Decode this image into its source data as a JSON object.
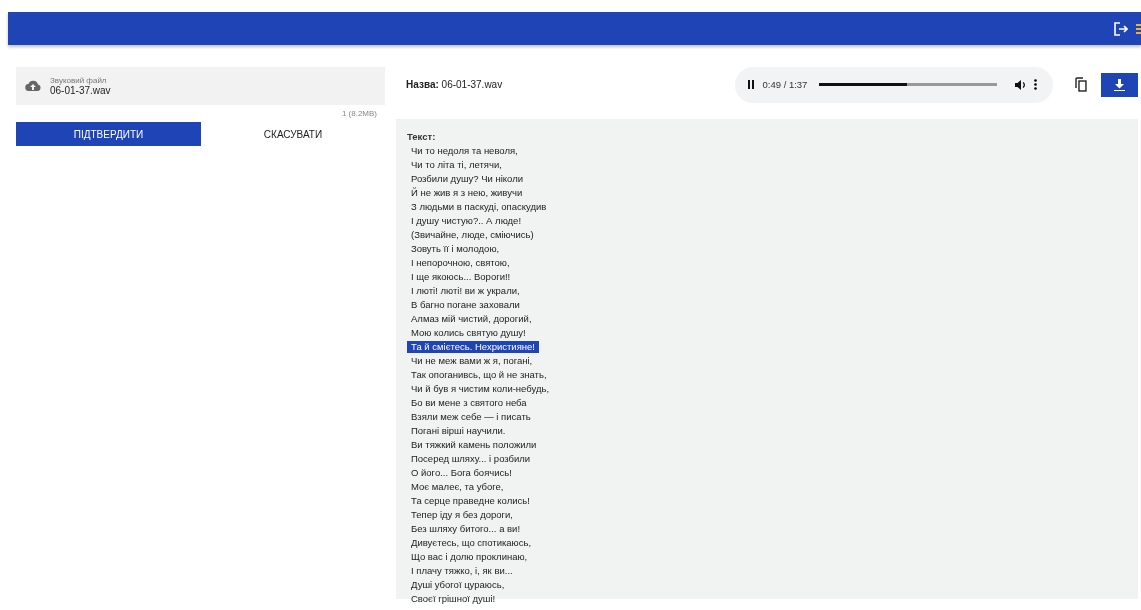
{
  "upload": {
    "label": "Звуковий файл",
    "value": "06-01-37.wav",
    "count": "1 (8.2MB)"
  },
  "buttons": {
    "confirm": "ПІДТВЕРДИТИ",
    "cancel": "СКАСУВАТИ"
  },
  "name": {
    "label": "Назва:",
    "value": "06-01-37.wav"
  },
  "player": {
    "playing": true,
    "time": "0:49 / 1:37",
    "level": 0.49
  },
  "text": {
    "label": "Текст:",
    "lines": [
      {
        "text": "Чи то недоля та неволя,",
        "selected": false
      },
      {
        "text": "Чи то літа ті, летячи,",
        "selected": false
      },
      {
        "text": "Розбили душу? Чи ніколи",
        "selected": false
      },
      {
        "text": "Й не жив я з нею, живучи",
        "selected": false
      },
      {
        "text": "З людьми в паскуді, опаскудив",
        "selected": false
      },
      {
        "text": "І душу чистую?.. А люде!",
        "selected": false
      },
      {
        "text": "(Звичайне, люде, сміючись)",
        "selected": false
      },
      {
        "text": "Зовуть її і молодою,",
        "selected": false
      },
      {
        "text": "І непорочною, святою,",
        "selected": false
      },
      {
        "text": "І ще якоюсь... Вороги!!",
        "selected": false
      },
      {
        "text": "І люті! люті! ви ж украли,",
        "selected": false
      },
      {
        "text": "В багно погане заховали",
        "selected": false
      },
      {
        "text": "Алмаз мій чистий, дорогий,",
        "selected": false
      },
      {
        "text": "Мою колись святую душу!",
        "selected": false
      },
      {
        "text": "Та й смієтесь. Нехристияне!",
        "selected": true
      },
      {
        "text": "Чи не меж вами ж я, погані,",
        "selected": false
      },
      {
        "text": "Так опоганивсь, що й не знать,",
        "selected": false
      },
      {
        "text": "Чи й був я чистим коли-небудь,",
        "selected": false
      },
      {
        "text": "Бо ви мене з святого неба",
        "selected": false
      },
      {
        "text": "Взяли меж себе — і писать",
        "selected": false
      },
      {
        "text": "Погані вірші научили.",
        "selected": false
      },
      {
        "text": "Ви тяжкий камень положили",
        "selected": false
      },
      {
        "text": "Посеред шляху... і розбили",
        "selected": false
      },
      {
        "text": "О його... Бога боячись!",
        "selected": false
      },
      {
        "text": "Моє малеє, та убоге,",
        "selected": false
      },
      {
        "text": "Та серце праведне колись!",
        "selected": false
      },
      {
        "text": "Тепер іду я без дороги,",
        "selected": false
      },
      {
        "text": "Без шляху битого... а ви!",
        "selected": false
      },
      {
        "text": "Дивуєтесь, що спотикаюсь,",
        "selected": false
      },
      {
        "text": "Що вас і долю проклинаю,",
        "selected": false
      },
      {
        "text": "І плачу тяжко, і, як ви...",
        "selected": false
      },
      {
        "text": "Душі убогої цураюсь,",
        "selected": false
      },
      {
        "text": "Своєї грішної душі!",
        "selected": false
      }
    ]
  }
}
